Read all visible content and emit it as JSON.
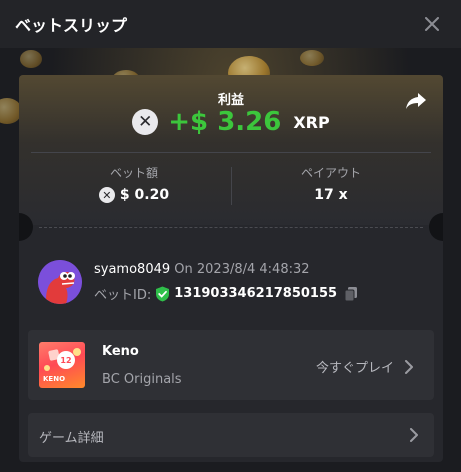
{
  "header": {
    "title": "ベットスリップ",
    "close_icon": "close-icon"
  },
  "profit": {
    "label": "利益",
    "amount": "+$ 3.26",
    "currency": "XRP",
    "currency_icon": "xrp-icon",
    "amount_color": "#3cc63c",
    "share_icon": "share-icon"
  },
  "stats": {
    "bet_amount_label": "ベット額",
    "bet_amount_value": "$ 0.20",
    "payout_label": "ペイアウト",
    "payout_value": "17 x"
  },
  "bet": {
    "username": "syamo8049",
    "date": "On 2023/8/4 4:48:32",
    "bet_id_label": "ベットID:",
    "bet_id": "131903346217850155",
    "verified_icon": "shield-check-icon",
    "copy_icon": "copy-icon"
  },
  "game": {
    "name": "Keno",
    "provider": "BC Originals",
    "thumb_text": "KENO",
    "thumb_number": "12",
    "play_label": "今すぐプレイ",
    "chevron_icon": "chevron-right-icon"
  },
  "details": {
    "label": "ゲーム詳細",
    "chevron_icon": "chevron-right-icon"
  }
}
